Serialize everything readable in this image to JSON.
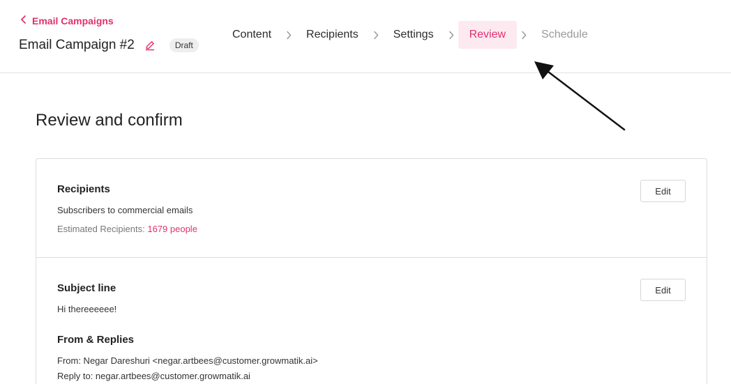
{
  "header": {
    "back_label": "Email Campaigns",
    "campaign_title": "Email Campaign #2",
    "status_badge": "Draft"
  },
  "steps": [
    {
      "label": "Content",
      "state": "done"
    },
    {
      "label": "Recipients",
      "state": "done"
    },
    {
      "label": "Settings",
      "state": "done"
    },
    {
      "label": "Review",
      "state": "active"
    },
    {
      "label": "Schedule",
      "state": "upcoming"
    }
  ],
  "main": {
    "heading": "Review and confirm",
    "recipients": {
      "title": "Recipients",
      "description": "Subscribers to commercial emails",
      "estimate_label": "Estimated Recipients:",
      "estimate_value": "1679 people",
      "edit_label": "Edit"
    },
    "subject": {
      "title": "Subject line",
      "value": "Hi thereeeeee!",
      "edit_label": "Edit"
    },
    "from_replies": {
      "title": "From & Replies",
      "from": "From: Negar Dareshuri <negar.artbees@customer.growmatik.ai>",
      "reply_to": "Reply to: negar.artbees@customer.growmatik.ai"
    }
  },
  "colors": {
    "accent": "#e0306f",
    "active_step_bg": "#fdeaf1",
    "muted_step": "#9a9a9a"
  },
  "icons": [
    "chevron-left-icon",
    "pencil-icon",
    "chevron-right-icon",
    "annotation-arrow-icon"
  ]
}
